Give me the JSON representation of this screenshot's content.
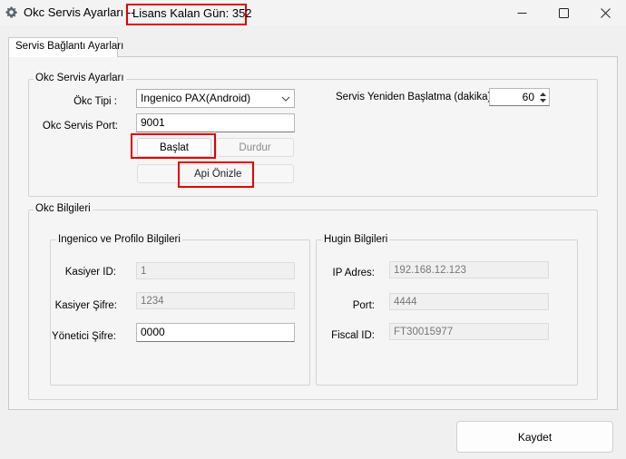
{
  "window": {
    "title": "Okc Servis Ayarları  --",
    "license_label": "Lisans Kalan Gün: 352"
  },
  "tabs": [
    {
      "label": "Servis Bağlantı Ayarları",
      "active": true
    }
  ],
  "service_settings": {
    "group_title": "Okc Servis Ayarları",
    "okc_type_label": "Ökc Tipi :",
    "okc_type_value": "Ingenico PAX(Android)",
    "port_label": "Okc Servis Port:",
    "port_value": "9001",
    "start_button": "Başlat",
    "stop_button": "Durdur",
    "api_preview_button": "Api Önizle",
    "restart_label": "Servis Yeniden Başlatma (dakika):",
    "restart_value": "60"
  },
  "okc_info": {
    "group_title": "Okc Bilgileri",
    "ingenico": {
      "group_title": "Ingenico ve Profilo Bilgileri",
      "cashier_id_label": "Kasiyer ID:",
      "cashier_id_value": "1",
      "cashier_password_label": "Kasiyer Şifre:",
      "cashier_password_value": "1234",
      "manager_password_label": "Yönetici Şifre:",
      "manager_password_value": "0000"
    },
    "hugin": {
      "group_title": "Hugin Bilgileri",
      "ip_label": "IP Adres:",
      "ip_value": "192.168.12.123",
      "port_label": "Port:",
      "port_value": "4444",
      "fiscal_label": "Fiscal ID:",
      "fiscal_value": "FT30015977"
    }
  },
  "footer": {
    "save_button": "Kaydet"
  },
  "colors": {
    "highlight_red": "#e00000",
    "window_bg": "#f0f0f0"
  }
}
